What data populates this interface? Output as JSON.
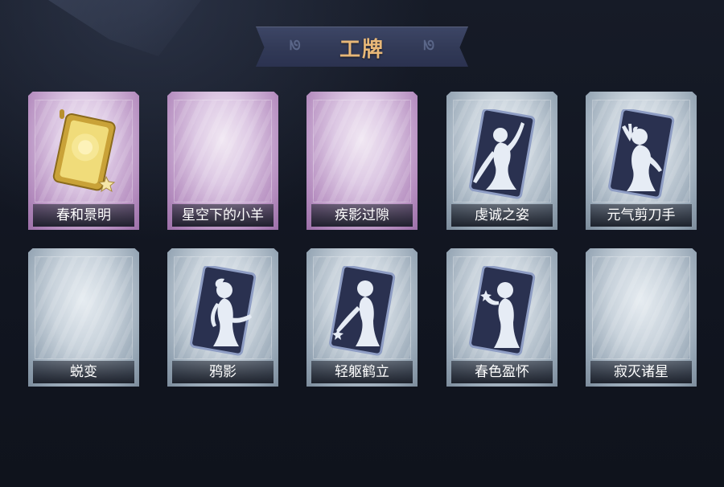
{
  "header": {
    "title": "工牌"
  },
  "cards": [
    {
      "label": "春和景明",
      "tier": "purple",
      "art": "gold-badge-icon"
    },
    {
      "label": "星空下的小羊",
      "tier": "purple",
      "art": "empty"
    },
    {
      "label": "疾影过隙",
      "tier": "purple",
      "art": "empty"
    },
    {
      "label": "虔诚之姿",
      "tier": "blue",
      "art": "pose-silhouette-icon"
    },
    {
      "label": "元气剪刀手",
      "tier": "blue",
      "art": "pose-silhouette-icon"
    },
    {
      "label": "蜕变",
      "tier": "blue",
      "art": "empty"
    },
    {
      "label": "鸦影",
      "tier": "blue",
      "art": "pose-silhouette-icon"
    },
    {
      "label": "轻躯鹤立",
      "tier": "blue",
      "art": "pose-silhouette-icon"
    },
    {
      "label": "春色盈怀",
      "tier": "blue",
      "art": "pose-silhouette-icon"
    },
    {
      "label": "寂灭诸星",
      "tier": "blue",
      "art": "empty"
    }
  ],
  "colors": {
    "background": "#121621",
    "title": "#e8b878",
    "banner": "#353d5c",
    "purple_tier": "#b790c1",
    "blue_tier": "#95a5b4"
  }
}
